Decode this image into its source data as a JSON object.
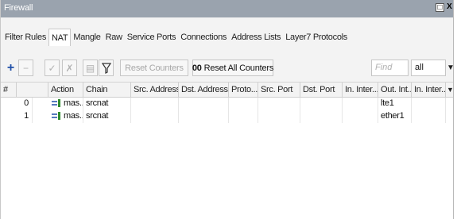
{
  "window": {
    "title": "Firewall",
    "restore_glyph": "□",
    "close_glyph": "X"
  },
  "tabs": [
    {
      "label": "Filter Rules",
      "active": false
    },
    {
      "label": "NAT",
      "active": true
    },
    {
      "label": "Mangle",
      "active": false
    },
    {
      "label": "Raw",
      "active": false
    },
    {
      "label": "Service Ports",
      "active": false
    },
    {
      "label": "Connections",
      "active": false
    },
    {
      "label": "Address Lists",
      "active": false
    },
    {
      "label": "Layer7 Protocols",
      "active": false
    }
  ],
  "toolbar": {
    "add_glyph": "+",
    "remove_glyph": "−",
    "enable_glyph": "✓",
    "disable_glyph": "✗",
    "comment_glyph": "▤",
    "filter_glyph": "▼",
    "reset_counters_label": "Reset Counters",
    "reset_all_prefix": "00",
    "reset_all_label": "Reset All Counters",
    "find_placeholder": "Find",
    "filter_value": "all",
    "filter_arrow": "▼",
    "accent": "#1f4fa8"
  },
  "table": {
    "columns": [
      "#",
      "",
      "Action",
      "Chain",
      "Src. Address",
      "Dst. Address",
      "Proto...",
      "Src. Port",
      "Dst. Port",
      "In. Inter...",
      "Out. Int...",
      "In. Inter...",
      "▼"
    ],
    "rows": [
      {
        "num": "0",
        "action": "mas...",
        "chain": "srcnat",
        "out_interface": "lte1"
      },
      {
        "num": "1",
        "action": "mas...",
        "chain": "srcnat",
        "out_interface": "ether1"
      }
    ]
  }
}
